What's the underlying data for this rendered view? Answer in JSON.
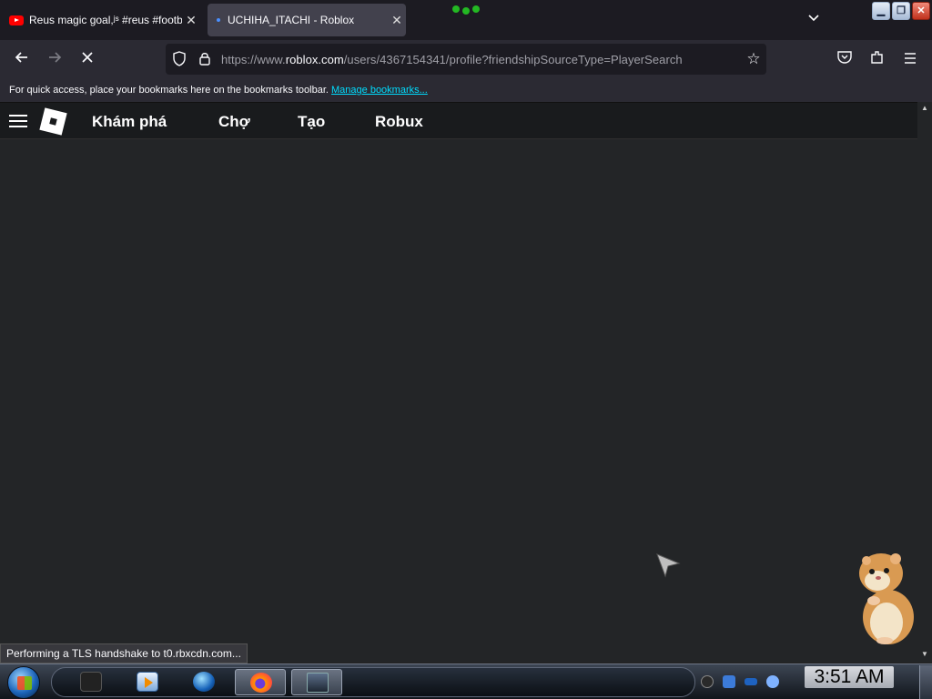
{
  "browser": {
    "tabs": [
      {
        "title": "Reus magic goal,ʲˢ #reus #footba",
        "icon": "youtube-icon",
        "active": false
      },
      {
        "title": "UCHIHA_ITACHI - Roblox",
        "icon": "loading-icon",
        "active": true
      }
    ],
    "url_prefix": "https://www.",
    "url_domain": "roblox.com",
    "url_path": "/users/4367154341/profile?friendshipSourceType=PlayerSearch",
    "bookmarks_hint": "For quick access, place your bookmarks here on the bookmarks toolbar.",
    "manage_bookmarks": "Manage bookmarks...",
    "status": "Performing a TLS handshake to t0.rbxcdn.com..."
  },
  "roblox": {
    "nav": [
      "Khám phá",
      "Chợ",
      "Tạo",
      "Robux"
    ]
  },
  "taskbar": {
    "clock": "3:51 AM",
    "items": [
      "monitor-icon",
      "media-player-icon",
      "globe-icon",
      "firefox-icon",
      "screen-icon"
    ]
  },
  "colors": {
    "browser_chrome": "#2b2a33",
    "tab_strip": "#1c1b22",
    "page_background": "#232527",
    "link": "#00ddff"
  }
}
